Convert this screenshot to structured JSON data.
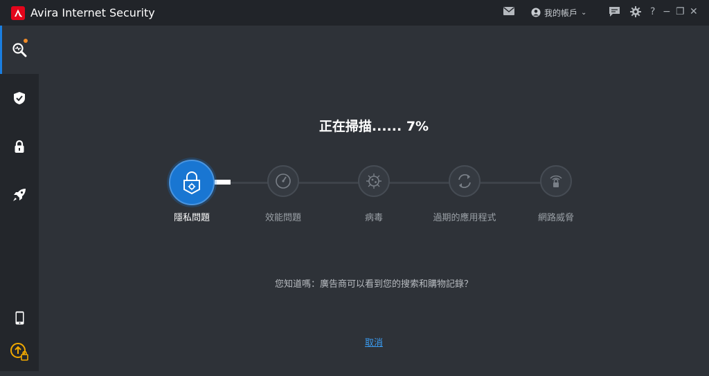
{
  "app": {
    "title": "Avira Internet Security",
    "logo_letter": "a",
    "brand_color": "#e3051b"
  },
  "titlebar": {
    "mail_icon": "mail-icon",
    "account_label": "我的帳戶",
    "chat_icon": "chat-icon",
    "settings_icon": "gear-icon",
    "help_label": "?",
    "minimize_label": "−",
    "restore_label": "❐",
    "close_label": "✕"
  },
  "sidebar": {
    "items": [
      {
        "name": "scan",
        "icon": "scan-magnifier-icon",
        "active": true,
        "notification": true
      },
      {
        "name": "protection",
        "icon": "shield-check-icon"
      },
      {
        "name": "privacy",
        "icon": "lock-icon"
      },
      {
        "name": "performance",
        "icon": "rocket-icon"
      },
      {
        "name": "mobile",
        "icon": "phone-icon"
      },
      {
        "name": "upgrade",
        "icon": "upgrade-icon",
        "color": "#f2a900"
      }
    ]
  },
  "scan": {
    "heading": "正在掃描...... 7%",
    "progress_percent": 7,
    "steps": [
      {
        "label": "隱私問題",
        "icon": "privacy-lock-icon",
        "active": true
      },
      {
        "label": "效能問題",
        "icon": "gauge-icon"
      },
      {
        "label": "病毒",
        "icon": "virus-icon"
      },
      {
        "label": "過期的應用程式",
        "icon": "refresh-cycle-icon"
      },
      {
        "label": "網路威脅",
        "icon": "network-lock-icon"
      }
    ],
    "tip": "您知道嗎：廣告商可以看到您的搜索和購物記錄？",
    "cancel_label": "取消",
    "accent_color": "#1976d2",
    "link_color": "#3a9bf0"
  }
}
